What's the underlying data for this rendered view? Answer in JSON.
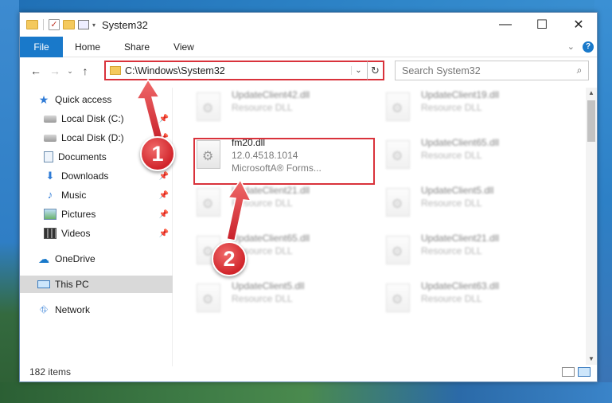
{
  "window": {
    "title": "System32",
    "controls": {
      "minimize": "—",
      "maximize": "☐",
      "close": "✕"
    }
  },
  "quick_access_toolbar": {
    "check_glyph": "✓",
    "dropdown_glyph": "▾"
  },
  "ribbon": {
    "file": "File",
    "tabs": [
      "Home",
      "Share",
      "View"
    ],
    "expand_glyph": "⌄",
    "help_glyph": "?"
  },
  "nav": {
    "back": "←",
    "forward": "→",
    "recent": "⌄",
    "up": "↑",
    "address": "C:\\Windows\\System32",
    "address_dropdown": "⌄",
    "refresh": "↻",
    "search_placeholder": "Search System32",
    "search_glyph": "⌕"
  },
  "sidebar": {
    "pin_glyph": "📌",
    "items": [
      {
        "label": "Quick access",
        "icon": "star-icon",
        "glyph": "★",
        "pinned": false
      },
      {
        "label": "Local Disk (C:)",
        "icon": "drive-icon",
        "glyph": "",
        "pinned": true
      },
      {
        "label": "Local Disk (D:)",
        "icon": "drive-icon",
        "glyph": "",
        "pinned": true
      },
      {
        "label": "Documents",
        "icon": "documents-icon",
        "glyph": "",
        "pinned": true
      },
      {
        "label": "Downloads",
        "icon": "download-icon",
        "glyph": "⬇",
        "pinned": true
      },
      {
        "label": "Music",
        "icon": "music-icon",
        "glyph": "♪",
        "pinned": true
      },
      {
        "label": "Pictures",
        "icon": "pictures-icon",
        "glyph": "",
        "pinned": true
      },
      {
        "label": "Videos",
        "icon": "videos-icon",
        "glyph": "",
        "pinned": true
      },
      {
        "label": "OneDrive",
        "icon": "cloud-icon",
        "glyph": "☁",
        "pinned": false
      },
      {
        "label": "This PC",
        "icon": "computer-icon",
        "glyph": "",
        "pinned": false,
        "selected": true
      },
      {
        "label": "Network",
        "icon": "network-icon",
        "glyph": "⛗",
        "pinned": false
      }
    ]
  },
  "files": [
    {
      "name": "UpdateClient42.dll",
      "type": "Resource DLL",
      "blurred": true
    },
    {
      "name": "UpdateClient19.dll",
      "type": "Resource DLL",
      "blurred": true
    },
    {
      "name": "fm20.dll",
      "version": "12.0.4518.1014",
      "description": "MicrosoftA® Forms...",
      "blurred": false
    },
    {
      "name": "UpdateClient65.dll",
      "type": "Resource DLL",
      "blurred": true
    },
    {
      "name": "UpdateClient21.dll",
      "type": "Resource DLL",
      "blurred": true
    },
    {
      "name": "UpdateClient5.dll",
      "type": "Resource DLL",
      "blurred": true
    },
    {
      "name": "UpdateClient65.dll",
      "type": "Resource DLL",
      "blurred": true
    },
    {
      "name": "UpdateClient21.dll",
      "type": "Resource DLL",
      "blurred": true
    },
    {
      "name": "UpdateClient5.dll",
      "type": "Resource DLL",
      "blurred": true
    },
    {
      "name": "UpdateClient63.dll",
      "type": "Resource DLL",
      "blurred": true
    }
  ],
  "scrollbar": {
    "up": "▲",
    "down": "▼"
  },
  "status": {
    "item_count": "182 items"
  },
  "callouts": {
    "one": "1",
    "two": "2"
  },
  "colors": {
    "accent": "#1979ca",
    "highlight": "#d9323b",
    "callout": "#d1252b"
  }
}
